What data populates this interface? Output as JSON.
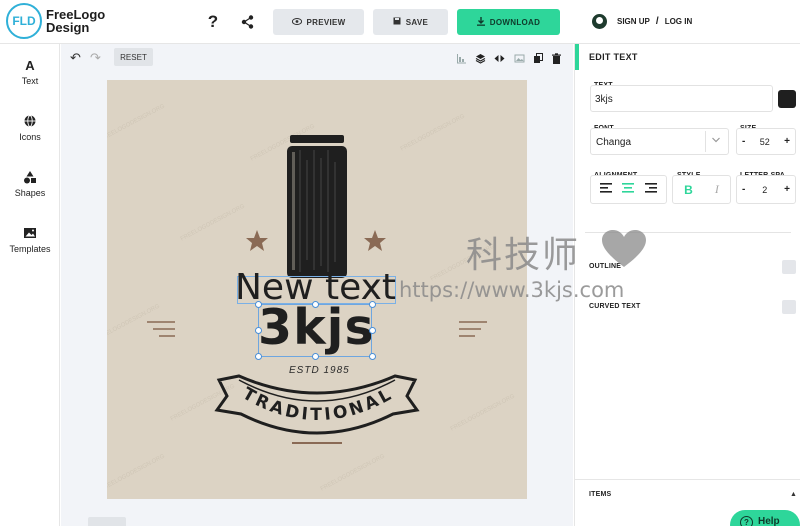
{
  "app": {
    "logo_badge": "FLD",
    "logo_line1": "FreeLogo",
    "logo_line2": "Design",
    "brand_color": "#2ed69a",
    "badge_color": "#2fb0d8"
  },
  "header": {
    "help_label": "?",
    "preview_label": "PREVIEW",
    "save_label": "SAVE",
    "download_label": "DOWNLOAD",
    "signup_label": "SIGN UP",
    "separator": "/",
    "login_label": "LOG IN"
  },
  "sidebar": {
    "items": [
      {
        "label": "Text",
        "icon": "text-icon"
      },
      {
        "label": "Icons",
        "icon": "globe-icon"
      },
      {
        "label": "Shapes",
        "icon": "shapes-icon"
      },
      {
        "label": "Templates",
        "icon": "image-icon"
      }
    ]
  },
  "canvas": {
    "undo": "↶",
    "redo": "↷",
    "reset_label": "RESET",
    "background_color": "#dcd3c4",
    "watermark": "FREELOGODESIGN.ORG",
    "new_text": "New text",
    "selected_text": "3kjs",
    "estd_text": "ESTD 1985",
    "banner_text": "TRADITIONAL",
    "accent_brown": "#8a6a55"
  },
  "panel": {
    "title": "EDIT TEXT",
    "text_label": "TEXT",
    "text_value": "3kjs",
    "text_color": "#1f1f1f",
    "font_label": "FONT",
    "font_value": "Changa",
    "size_label": "SIZE",
    "size_value": "52",
    "alignment_label": "ALIGNMENT",
    "style_label": "STYLE",
    "style_bold": "B",
    "style_italic": "I",
    "letter_spacing_label": "LETTER SPA...",
    "letter_spacing_value": "2",
    "minus": "-",
    "plus": "+",
    "outline_label": "OUTLINE",
    "curved_label": "CURVED TEXT",
    "items_label": "ITEMS"
  },
  "overlay": {
    "site_name_cn": "科技师",
    "site_url": "https://www.3kjs.com"
  },
  "help": {
    "label": "Help",
    "q": "?"
  }
}
